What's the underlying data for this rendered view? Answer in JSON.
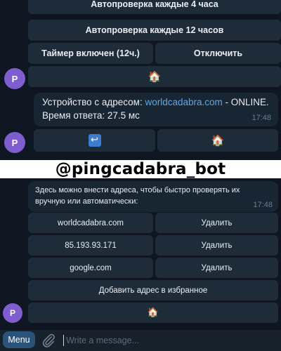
{
  "top_chat": {
    "keyboard1": {
      "buttons": [
        {
          "label": "Автопроверка каждые 4 часа"
        },
        {
          "label": "Автопроверка каждые 12 часов"
        },
        {
          "label": "Таймер включен (12ч.)"
        },
        {
          "label": "Отключить"
        },
        {
          "label": "🏠"
        }
      ]
    },
    "avatar_letter": "P",
    "message": {
      "text_before_link": "Устройство с адресом: ",
      "link": "worldcadabra.com",
      "text_after_link": " - ONLINE.",
      "line2": "Время ответа: 27.5 мс",
      "time": "17:48"
    },
    "keyboard2": {
      "buttons": [
        {
          "label": "↩"
        },
        {
          "label": "🏠"
        }
      ]
    },
    "avatar2_letter": "P"
  },
  "banner": {
    "text": "@pingcadabra_bot"
  },
  "bottom_chat": {
    "message": {
      "line1": "Здесь можно внести адреса, чтобы быстро проверять их",
      "line2": "вручную или автоматически:",
      "time": "17:48"
    },
    "keyboard": {
      "rows": [
        {
          "address": "worldcadabra.com",
          "action": "Удалить"
        },
        {
          "address": "85.193.93.171",
          "action": "Удалить"
        },
        {
          "address": "google.com",
          "action": "Удалить"
        }
      ],
      "add_label": "Добавить адрес в избранное",
      "home_label": "🏠"
    },
    "avatar_letter": "P"
  },
  "composer": {
    "menu_label": "Menu",
    "attach_icon": "paperclip-icon",
    "placeholder": "Write a message..."
  },
  "colors": {
    "background": "#0e1621",
    "button": "#1e2c3a",
    "bubble": "#182533",
    "avatar": "#7e5ecf",
    "link": "#5ea8e8",
    "menu_button": "#2b5278"
  }
}
